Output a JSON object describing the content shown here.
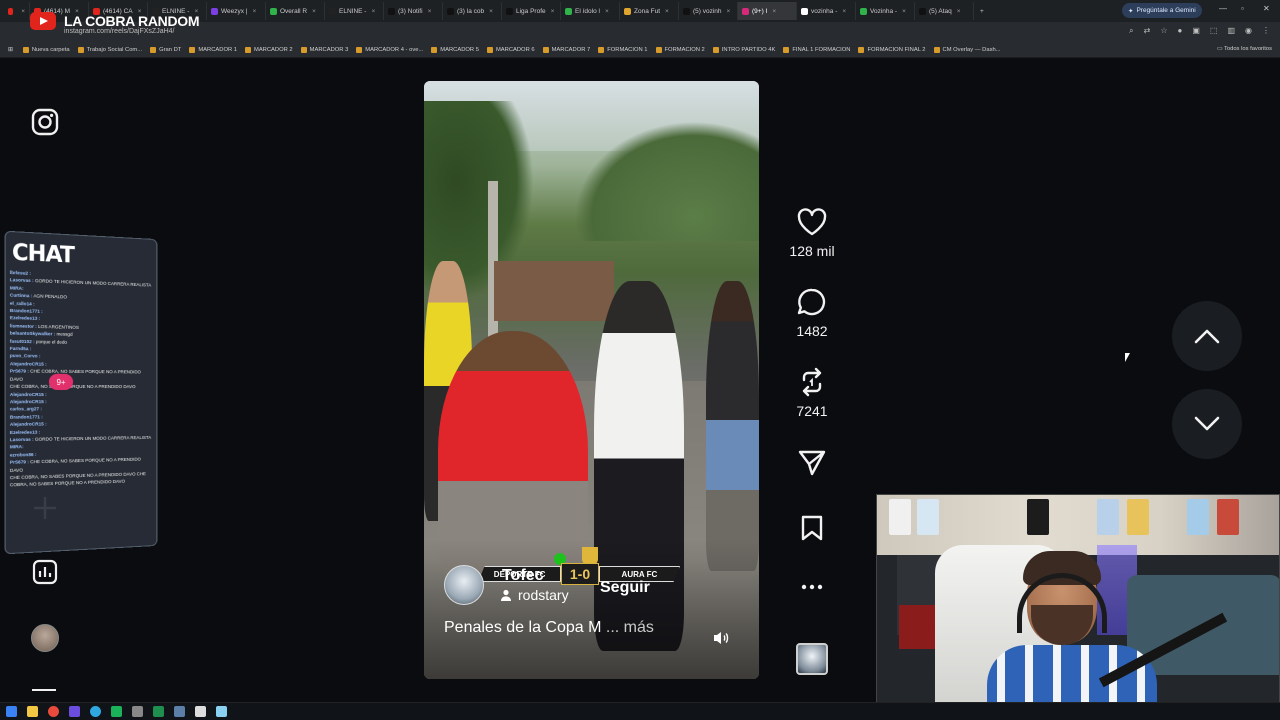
{
  "browser": {
    "tabs": [
      {
        "label": "",
        "color": "#e1241c"
      },
      {
        "label": "(4614) M",
        "color": "#e1241c"
      },
      {
        "label": "(4614) CA",
        "color": "#e1241c"
      },
      {
        "label": "ELNINE -",
        "color": "#222222"
      },
      {
        "label": "Weezyx |",
        "color": "#7b3fe4"
      },
      {
        "label": "Overall R",
        "color": "#2fb34a"
      },
      {
        "label": "ELNINE -",
        "color": "#222222"
      },
      {
        "label": "(3) Notifi",
        "color": "#111111"
      },
      {
        "label": "(3) la cob",
        "color": "#111111"
      },
      {
        "label": "Liga Profe",
        "color": "#111111"
      },
      {
        "label": "El ídolo l",
        "color": "#2fb34a"
      },
      {
        "label": "Zona Fut",
        "color": "#e0a52c"
      },
      {
        "label": "(5) vozinh",
        "color": "#111111"
      },
      {
        "label": "(9+) I",
        "color": "#d6297b"
      },
      {
        "label": "vozinha -",
        "color": "#ffffff"
      },
      {
        "label": "Vozinha -",
        "color": "#2fb34a"
      },
      {
        "label": "(5) Ataq",
        "color": "#111111"
      }
    ],
    "gemini_label": "Pregúntale a Gemini",
    "page_title": "LA COBRA RANDOM",
    "url": "instagram.com/reels/DajFXsZJaH4/",
    "bookmarks": [
      "Nueva carpeta",
      "Trabajo Social Com...",
      "Gran DT",
      "MARCADOR 1",
      "MARCADOR 2",
      "MARCADOR 3",
      "MARCADOR 4 - ove...",
      "MARCADOR 5",
      "MARCADOR 6",
      "MARCADOR 7",
      "FORMACION 1",
      "FORMACION 2",
      "INTRO PARTIDO 4K",
      "FINAL 1 FORMACION",
      "FORMACION FINAL 2",
      "CM Overlay — Dash..."
    ],
    "bookmarks_right": "Todos los favoritos"
  },
  "chat": {
    "title": "CHAT",
    "badge": "9+",
    "messages": [
      {
        "user": "lbrlesu2 :",
        "text": ""
      },
      {
        "user": "Lasorvas :",
        "text": "GORDO TE HICIERON UN MODO CARRERA REALISTA"
      },
      {
        "user": "MIRA:",
        "text": ""
      },
      {
        "user": "Curtinna :",
        "text": "AGN PENALDO"
      },
      {
        "user": "el_rallo14 :",
        "text": ""
      },
      {
        "user": "Brandon1771 :",
        "text": ""
      },
      {
        "user": "Ezelredes13 :",
        "text": ""
      },
      {
        "user": "lismnestor :",
        "text": "LOS ARGENTINOS"
      },
      {
        "user": "belsantoSkywalker :",
        "text": "messgd"
      },
      {
        "user": "fasut0102 :",
        "text": "porque el dedo"
      },
      {
        "user": "Farnd5a :",
        "text": ""
      },
      {
        "user": "puvo_Corvo :",
        "text": ""
      },
      {
        "user": "AlejandroCR15 :",
        "text": ""
      },
      {
        "user": "PrS679 :",
        "text": "CHE COBRA, NO SABES PORQUE NO A PRENDIDO DAVO"
      },
      {
        "user": "",
        "text": "CHE COBRA, NO SABES PORQUE NO A PRENDIDO DAVO"
      },
      {
        "user": "AlejandroCR15 :",
        "text": ""
      },
      {
        "user": "AlejandroCR15 :",
        "text": ""
      },
      {
        "user": "carlos_arg27 :",
        "text": ""
      },
      {
        "user": "Brandon1771 :",
        "text": ""
      },
      {
        "user": "AlejandroCR15 :",
        "text": ""
      },
      {
        "user": "Ezelredes13 :",
        "text": ""
      },
      {
        "user": "Lasorvas :",
        "text": "GORDO TE HICIERON UN MODO CARRERA REALISTA"
      },
      {
        "user": "MIRA:",
        "text": ""
      },
      {
        "user": "ezrobon86 :",
        "text": ""
      },
      {
        "user": "PrS679 :",
        "text": "CHE COBRA, NO SABES PORQUE NO A PRENDIDO DAVO"
      },
      {
        "user": "",
        "text": "CHE COBRA, NO SABES PORQUE NO A PRENDIDO DAVO CHE COBRA, NO SABES PORQUE NO A PRENDIDO DAVO"
      }
    ]
  },
  "reel": {
    "scoreboard": {
      "home": "DEPORTE FC",
      "score": "1-0",
      "away": "AURA FC"
    },
    "owner": "Tofec",
    "follow_label": "Seguir",
    "username": "rodstary",
    "caption": "Penales de la Copa M",
    "more": "... más"
  },
  "actions": {
    "likes": "128 mil",
    "comments": "1482",
    "reposts": "7241"
  },
  "colors": {
    "background": "#0a0c0f",
    "accent": "#d6297b"
  }
}
